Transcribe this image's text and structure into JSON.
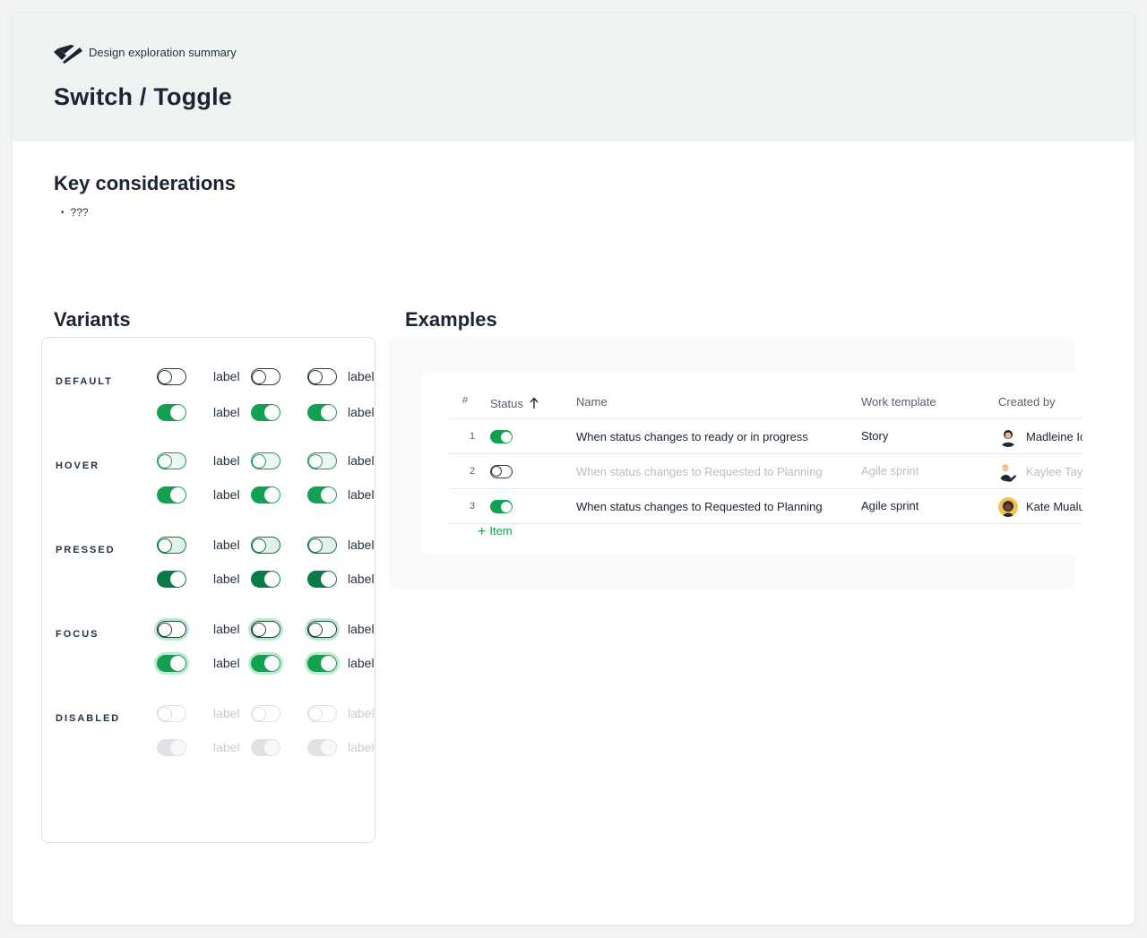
{
  "header": {
    "eyebrow": "Design exploration summary",
    "title": "Switch / Toggle"
  },
  "key_considerations": {
    "title": "Key considerations",
    "bullets": [
      "???"
    ]
  },
  "variants": {
    "title": "Variants",
    "states": [
      "DEFAULT",
      "HOVER",
      "PRESSED",
      "FOCUS",
      "DISABLED"
    ],
    "toggle_label": "label"
  },
  "examples": {
    "title": "Examples",
    "columns": [
      "#",
      "Status",
      "Name",
      "Work template",
      "Created by"
    ],
    "sort_icon": "arrow-up-icon",
    "rows": [
      {
        "num": "1",
        "status": "on",
        "name": "When status changes to ready or in progress",
        "template": "Story",
        "creator": "Madleine Ickes",
        "muted": false
      },
      {
        "num": "2",
        "status": "off",
        "name": "When  status changes to Requested to Planning",
        "template": "Agile sprint",
        "creator": "Kaylee Taylor",
        "muted": true
      },
      {
        "num": "3",
        "status": "on",
        "name": "When status changes to Requested to Planning",
        "template": "Agile sprint",
        "creator": "Kate Mualuko",
        "muted": false
      }
    ],
    "add_item": "Item"
  },
  "colors": {
    "accent": "#12a150",
    "header_bg": "#edf4f2",
    "text": "#1a2433"
  }
}
